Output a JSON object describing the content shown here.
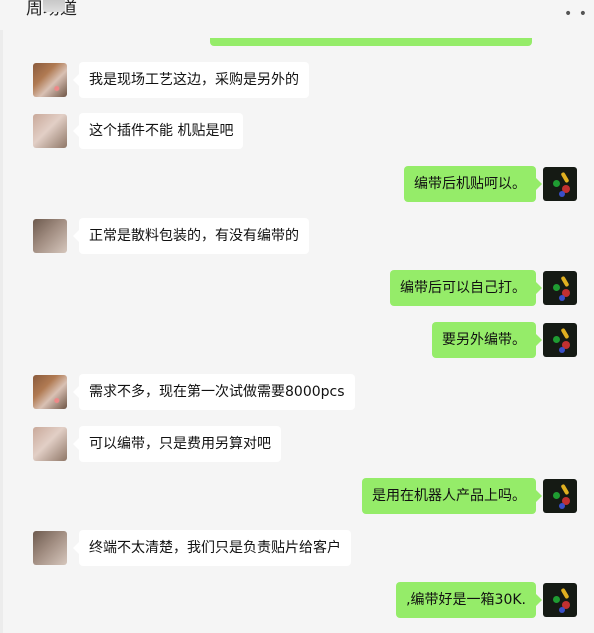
{
  "header": {
    "title": "周场道",
    "more_icon": "more-dots-icon"
  },
  "messages": [
    {
      "side": "in",
      "text": "我是现场工艺这边，采购是另外的"
    },
    {
      "side": "in",
      "text": "这个插件不能 机贴是吧"
    },
    {
      "side": "out",
      "text": "编带后机贴呵以。"
    },
    {
      "side": "in",
      "text": "正常是散料包装的，有没有编带的"
    },
    {
      "side": "out",
      "text": "编带后可以自己打。"
    },
    {
      "side": "out",
      "text": "要另外编带。"
    },
    {
      "side": "in",
      "text": "需求不多，现在第一次试做需要8000pcs"
    },
    {
      "side": "in",
      "text": "可以编带，只是费用另算对吧"
    },
    {
      "side": "out",
      "text": "是用在机器人产品上吗。"
    },
    {
      "side": "in",
      "text": "终端不太清楚，我们只是负责贴片给客户"
    },
    {
      "side": "out",
      "text": ",编带好是一箱30K."
    }
  ],
  "colors": {
    "background": "#f5f5f5",
    "incoming_bubble": "#ffffff",
    "outgoing_bubble": "#95ec69"
  }
}
